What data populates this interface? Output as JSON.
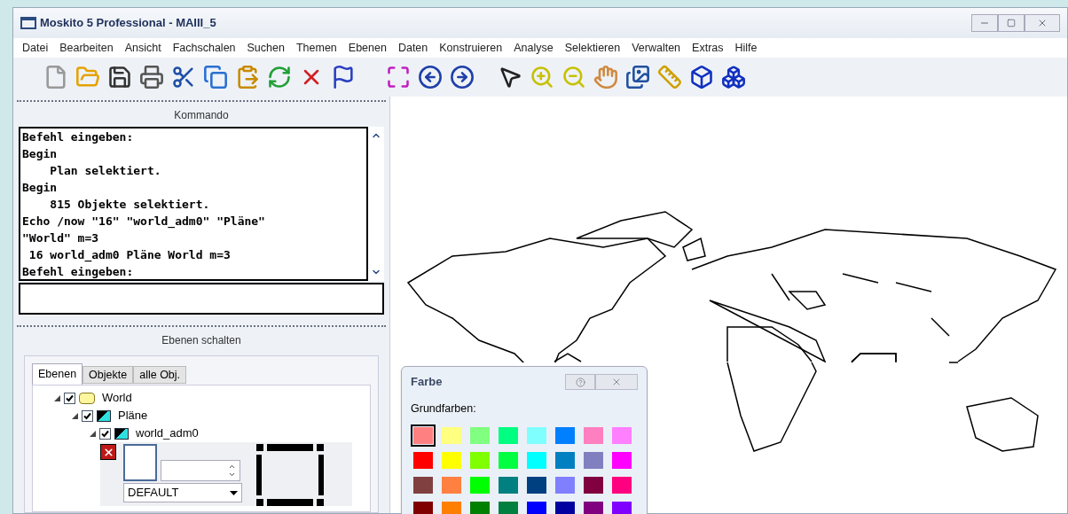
{
  "window": {
    "title": "Moskito 5 Professional - MAIII_5"
  },
  "menu": [
    "Datei",
    "Bearbeiten",
    "Ansicht",
    "Fachschalen",
    "Suchen",
    "Themen",
    "Ebenen",
    "Daten",
    "Konstruieren",
    "Analyse",
    "Selektieren",
    "Verwalten",
    "Extras",
    "Hilfe"
  ],
  "command_panel": {
    "title": "Kommando",
    "lines": [
      "Befehl eingeben:",
      "Begin",
      "    Plan selektiert.",
      "Begin",
      "    815 Objekte selektiert.",
      "Echo /now \"16\" \"world_adm0\" \"Pläne\"",
      "\"World\" m=3",
      " 16 world_adm0 Pläne World m=3",
      "Befehl eingeben:"
    ]
  },
  "layers_panel": {
    "title": "Ebenen schalten",
    "tabs": [
      {
        "label": "Ebenen",
        "selected": true
      },
      {
        "label": "Objekte",
        "selected": false
      },
      {
        "label": "alle Obj.",
        "selected": false
      }
    ],
    "tree": [
      {
        "label": "World",
        "kind": "folder",
        "checked": true,
        "expanded": true,
        "children": [
          {
            "label": "Pläne",
            "kind": "layer",
            "checked": true,
            "expanded": true,
            "children": [
              {
                "label": "world_adm0",
                "kind": "layer",
                "checked": true,
                "expanded": true
              }
            ]
          }
        ]
      }
    ],
    "style_dropdown": "DEFAULT"
  },
  "color_dialog": {
    "title": "Farbe",
    "section": "Grundfarben:",
    "swatches": [
      {
        "color": "#ff8080",
        "selected": true
      },
      {
        "color": "#ffff80",
        "selected": false
      },
      {
        "color": "#80ff80",
        "selected": false
      },
      {
        "color": "#00ff80",
        "selected": false
      },
      {
        "color": "#80ffff",
        "selected": false
      },
      {
        "color": "#0080ff",
        "selected": false
      },
      {
        "color": "#ff80c0",
        "selected": false
      },
      {
        "color": "#ff80ff",
        "selected": false
      },
      {
        "color": "#ff0000",
        "selected": false
      },
      {
        "color": "#ffff00",
        "selected": false
      },
      {
        "color": "#80ff00",
        "selected": false
      },
      {
        "color": "#00ff40",
        "selected": false
      },
      {
        "color": "#00ffff",
        "selected": false
      },
      {
        "color": "#0080c0",
        "selected": false
      },
      {
        "color": "#8080c0",
        "selected": false
      },
      {
        "color": "#ff00ff",
        "selected": false
      },
      {
        "color": "#804040",
        "selected": false
      },
      {
        "color": "#ff8040",
        "selected": false
      },
      {
        "color": "#00ff00",
        "selected": false
      },
      {
        "color": "#008080",
        "selected": false
      },
      {
        "color": "#004080",
        "selected": false
      },
      {
        "color": "#8080ff",
        "selected": false
      },
      {
        "color": "#800040",
        "selected": false
      },
      {
        "color": "#ff0080",
        "selected": false
      },
      {
        "color": "#800000",
        "selected": false
      },
      {
        "color": "#ff8000",
        "selected": false
      },
      {
        "color": "#008000",
        "selected": false
      },
      {
        "color": "#008040",
        "selected": false
      },
      {
        "color": "#0000ff",
        "selected": false
      },
      {
        "color": "#0000a0",
        "selected": false
      },
      {
        "color": "#800080",
        "selected": false
      },
      {
        "color": "#8000ff",
        "selected": false
      }
    ]
  }
}
